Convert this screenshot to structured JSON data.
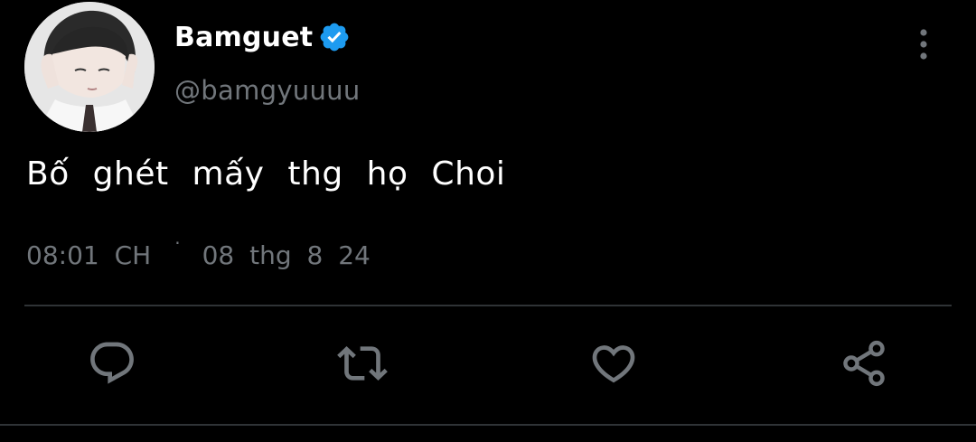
{
  "author": {
    "display_name": "Bamguet",
    "handle": "@bamgyuuuu",
    "verified": true,
    "verified_color": "#1d9bf0"
  },
  "tweet": {
    "text": "Bố ghét mấy thg họ Choi",
    "time": "08:01 CH",
    "separator": "·",
    "date": "08 thg 8 24"
  },
  "icons": {
    "more": "more-vertical-icon",
    "reply": "reply-icon",
    "retweet": "retweet-icon",
    "like": "heart-icon",
    "share": "share-icon"
  },
  "colors": {
    "background": "#000000",
    "primary_text": "#ffffff",
    "secondary_text": "#71767b",
    "divider": "#2f3336",
    "icon": "#71767b"
  }
}
